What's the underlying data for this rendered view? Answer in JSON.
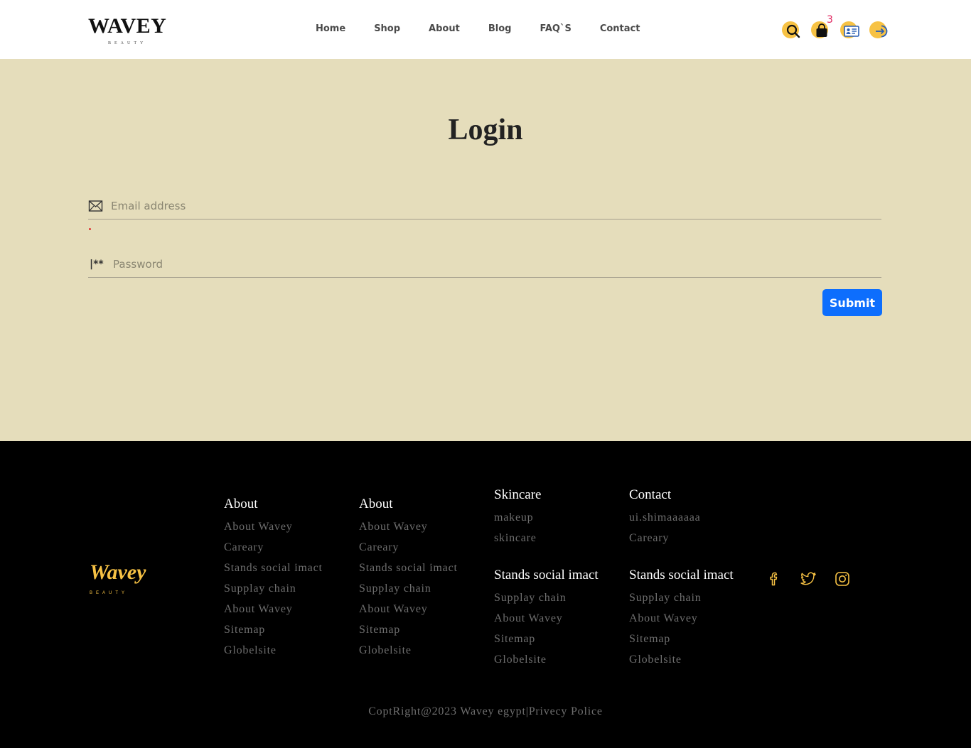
{
  "header": {
    "logo": "WAVEY",
    "logo_sub": "BEAUTY",
    "nav": [
      "Home",
      "Shop",
      "About",
      "Blog",
      "FAQ`S",
      "Contact"
    ],
    "cart_count": "3",
    "icons": [
      "search-icon",
      "shopping-bag-icon",
      "profile-card-icon",
      "sign-in-icon"
    ],
    "accent_color": "#f7c244"
  },
  "login": {
    "title": "Login",
    "email_placeholder": "Email address",
    "password_placeholder": "Password",
    "password_glyph": "|**",
    "submit_label": "Submit",
    "background": "#e5ddbb",
    "button_color": "#0d6efd"
  },
  "footer": {
    "logo": "Wavey",
    "logo_sub": "BEAUTY",
    "columns": [
      {
        "title": "About",
        "links": [
          "About Wavey",
          "Careary",
          "Stands social imact",
          "Supplay chain",
          "About Wavey",
          "Sitemap",
          "Globelsite"
        ]
      },
      {
        "title": "About",
        "links": [
          "About Wavey",
          "Careary",
          "Stands social imact",
          "Supplay chain",
          "About Wavey",
          "Sitemap",
          "Globelsite"
        ]
      },
      {
        "title": "Skincare",
        "links": [
          "makeup",
          "skincare"
        ]
      },
      {
        "title": "Contact",
        "links": [
          "ui.shimaaaaaa",
          "Careary"
        ]
      },
      {
        "title": "Stands social imact",
        "links": [
          "Supplay chain",
          "About Wavey",
          "Sitemap",
          "Globelsite"
        ]
      },
      {
        "title": "Stands social imact",
        "links": [
          "Supplay chain",
          "About Wavey",
          "Sitemap",
          "Globelsite"
        ]
      }
    ],
    "social": [
      "facebook-icon",
      "twitter-icon",
      "instagram-icon"
    ],
    "copyright": "CoptRight@2023 Wavey egypt|Privecy Police"
  }
}
